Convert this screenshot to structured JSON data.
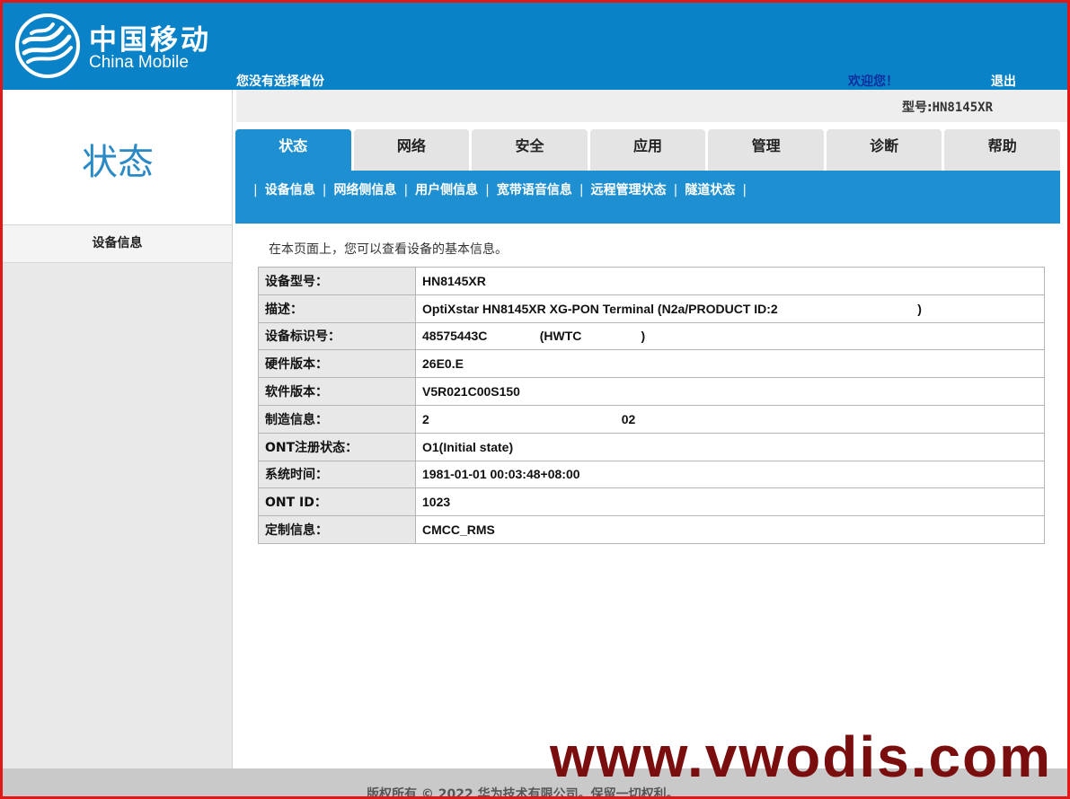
{
  "brand": {
    "name_cn": "中国移动",
    "name_en": "China Mobile",
    "logo_icon": "china-mobile-logo-icon"
  },
  "header": {
    "province": "您没有选择省份",
    "welcome": "欢迎您！",
    "logout": "退出"
  },
  "model_bar": {
    "label": "型号:",
    "value": "HN8145XR"
  },
  "page_title": "状态",
  "tabs": [
    {
      "label": "状态",
      "active": true
    },
    {
      "label": "网络"
    },
    {
      "label": "安全"
    },
    {
      "label": "应用"
    },
    {
      "label": "管理"
    },
    {
      "label": "诊断"
    },
    {
      "label": "帮助"
    }
  ],
  "subnav": [
    {
      "label": "设备信息"
    },
    {
      "label": "网络侧信息"
    },
    {
      "label": "用户侧信息"
    },
    {
      "label": "宽带语音信息"
    },
    {
      "label": "远程管理状态"
    },
    {
      "label": "隧道状态"
    }
  ],
  "subnav_sep": "|",
  "left_nav": {
    "items": [
      {
        "label": "设备信息"
      }
    ]
  },
  "content": {
    "intro": "在本页面上，您可以查看设备的基本信息。",
    "rows": [
      {
        "key": "设备型号：",
        "value": "HN8145XR"
      },
      {
        "key": "描述：",
        "value": "OptiXstar HN8145XR XG-PON Terminal (N2a/PRODUCT ID:2                                        )"
      },
      {
        "key": "设备标识号：",
        "value": "48575443C               (HWTC                 )"
      },
      {
        "key": "硬件版本：",
        "value": "26E0.E"
      },
      {
        "key": "软件版本：",
        "value": "V5R021C00S150"
      },
      {
        "key": "制造信息：",
        "value": "2                                                       02"
      },
      {
        "key": "ONT注册状态：",
        "value": "O1(Initial state)"
      },
      {
        "key": "系统时间：",
        "value": "1981-01-01 00:03:48+08:00"
      },
      {
        "key": "ONT ID：",
        "value": "1023"
      },
      {
        "key": "定制信息：",
        "value": "CMCC_RMS"
      }
    ]
  },
  "footer": {
    "copyright": "版权所有 © 2022 华为技术有限公司。保留一切权利。"
  },
  "watermark": "www.vwodis.com",
  "colors": {
    "header_blue": "#0a82c8",
    "tab_blue": "#1e90d2",
    "title_blue": "#2a8ac5",
    "welcome_navy": "#0c2f9c",
    "watermark_red": "#7a0d0d",
    "frame_red": "#e01818"
  }
}
